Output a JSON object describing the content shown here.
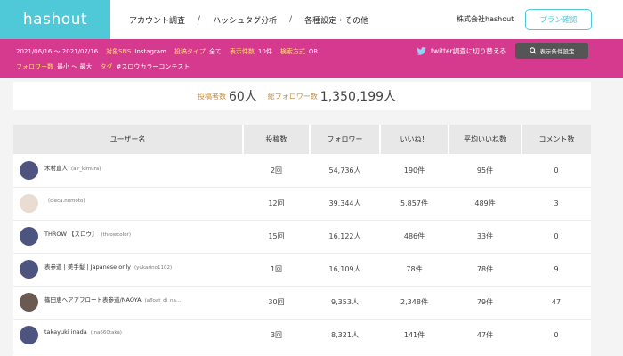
{
  "header": {
    "logo_text": "hashout",
    "nav": [
      "アカウント調査",
      "ハッシュタグ分析",
      "各種設定・その他"
    ],
    "nav_sep": "/",
    "company": "株式会社hashout",
    "plan_button": "プラン確認"
  },
  "filters": {
    "period": "2021/06/16 〜 2021/07/16",
    "sns_label": "対象SNS",
    "sns_value": "Instagram",
    "post_type_label": "投稿タイプ",
    "post_type_value": "全て",
    "count_label": "表示件数",
    "count_value": "10件",
    "search_label": "検索方式",
    "search_value": "OR",
    "followers_label": "フォロワー数",
    "followers_value": "最小 〜 最大",
    "tag_label": "タグ",
    "tag_value": "#スロウカラーコンテスト",
    "twitter_switch": "twitter調査に切り替える",
    "display_settings": "表示条件設定"
  },
  "summary": {
    "posters_label": "投稿者数",
    "posters_value": "60人",
    "followers_label": "総フォロワー数",
    "followers_value": "1,350,199人"
  },
  "table": {
    "headers": [
      "ユーザー名",
      "投稿数",
      "フォロワー",
      "いいね！",
      "平均いいね数",
      "コメント数"
    ],
    "rows": [
      {
        "name": "木村直人",
        "id": "(air_kimura)",
        "posts": "2回",
        "followers": "54,736人",
        "likes": "190件",
        "avg": "95件",
        "comments": "0"
      },
      {
        "name": "",
        "id": "(cieca.nomoto)",
        "posts": "12回",
        "followers": "39,344人",
        "likes": "5,857件",
        "avg": "489件",
        "comments": "3"
      },
      {
        "name": "THROW 【スロウ】",
        "id": "(throwcolor)",
        "posts": "15回",
        "followers": "16,122人",
        "likes": "486件",
        "avg": "33件",
        "comments": "0"
      },
      {
        "name": "表参道 | 美手髪 | Japanese only",
        "id": "(yukarino1102)",
        "posts": "1回",
        "followers": "16,109人",
        "likes": "78件",
        "avg": "78件",
        "comments": "9"
      },
      {
        "name": "篠田恵ヘアアフロート表参道/NAOYA",
        "id": "(afloat_di_na…",
        "posts": "30回",
        "followers": "9,353人",
        "likes": "2,348件",
        "avg": "79件",
        "comments": "47"
      },
      {
        "name": "takayuki inada",
        "id": "(ina660taka)",
        "posts": "3回",
        "followers": "8,321人",
        "likes": "141件",
        "avg": "47件",
        "comments": "0"
      }
    ]
  }
}
